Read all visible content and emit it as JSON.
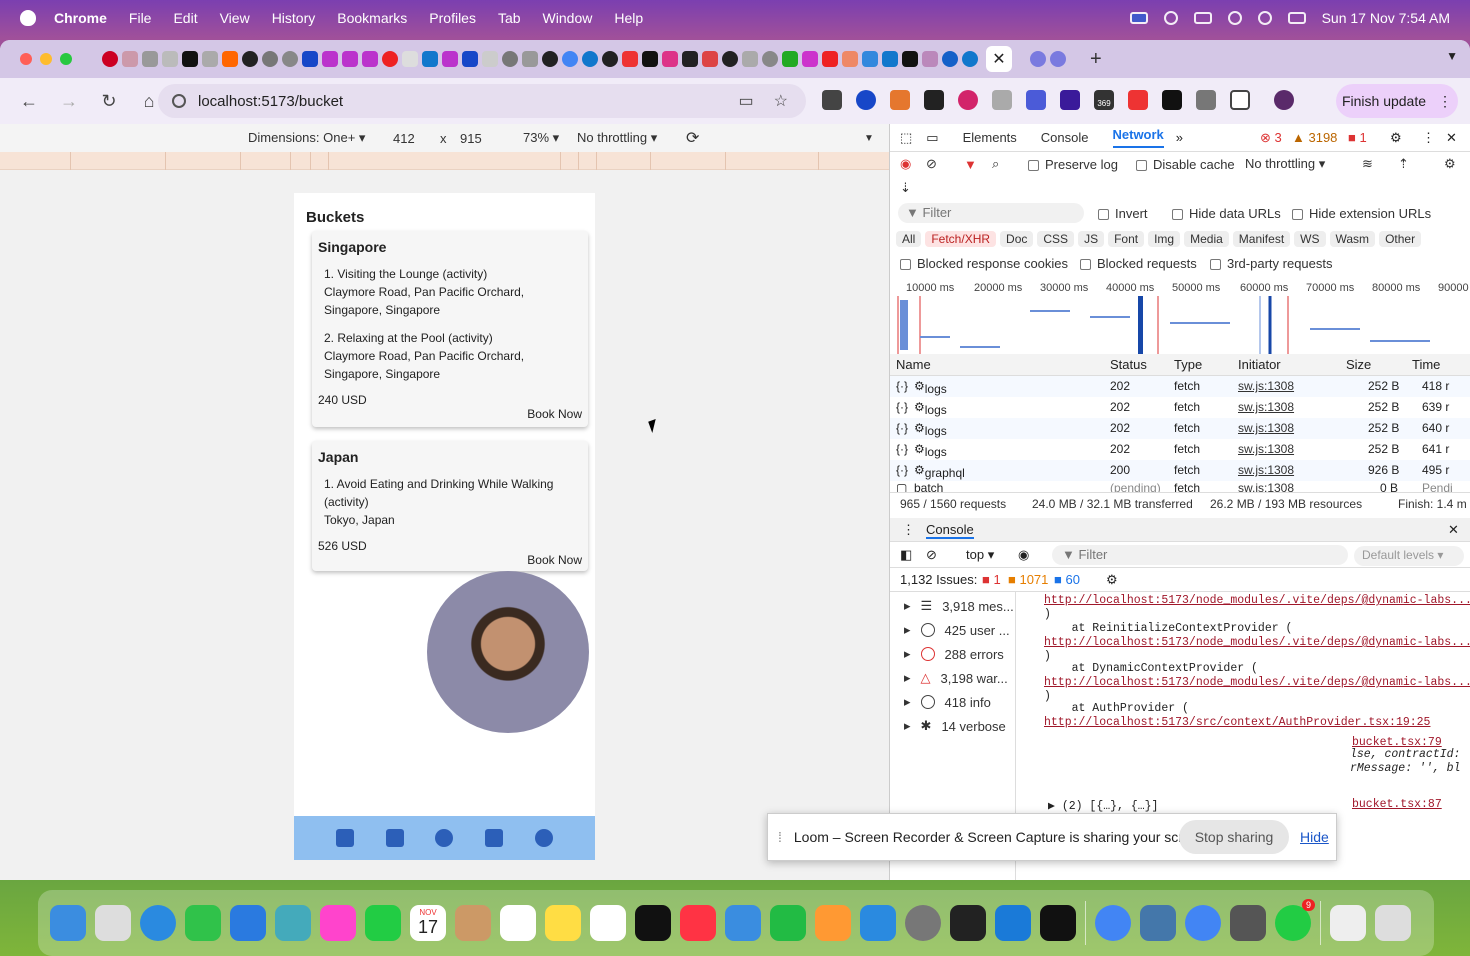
{
  "menubar": {
    "app_name": "Chrome",
    "items": [
      "File",
      "Edit",
      "View",
      "History",
      "Bookmarks",
      "Profiles",
      "Tab",
      "Window",
      "Help"
    ],
    "datetime": "Sun 17 Nov  7:54 AM"
  },
  "browser": {
    "url": "localhost:5173/bucket",
    "finish_update": "Finish update",
    "ext_badge": "369",
    "ext_badge_6": "6"
  },
  "device_toolbar": {
    "dimensions": "Dimensions: One+",
    "width": "412",
    "x": "x",
    "height": "915",
    "zoom": "73%",
    "throttle": "No throttling"
  },
  "app": {
    "title": "Buckets",
    "cards": [
      {
        "country": "Singapore",
        "items": [
          {
            "line1": "1. Visiting the Lounge (activity)",
            "line2": "Claymore Road, Pan Pacific Orchard,",
            "line3": "Singapore, Singapore"
          },
          {
            "line1": "2. Relaxing at the Pool (activity)",
            "line2": "Claymore Road, Pan Pacific Orchard,",
            "line3": "Singapore, Singapore"
          }
        ],
        "price": "240 USD",
        "book": "Book Now"
      },
      {
        "country": "Japan",
        "items": [
          {
            "line1": "1. Avoid Eating and Drinking While Walking",
            "line2": "(activity)",
            "line3": "Tokyo, Japan"
          }
        ],
        "price": "526 USD",
        "book": "Book Now"
      }
    ]
  },
  "devtools": {
    "tabs": [
      "Elements",
      "Console",
      "Network"
    ],
    "errors": "3",
    "warnings": "3198",
    "issues_count": "1",
    "preserve_log": "Preserve log",
    "disable_cache": "Disable cache",
    "throttling": "No throttling",
    "filter_placeholder": "Filter",
    "invert": "Invert",
    "hide_data_urls": "Hide data URLs",
    "hide_ext_urls": "Hide extension URLs",
    "filter_types": [
      "All",
      "Fetch/XHR",
      "Doc",
      "CSS",
      "JS",
      "Font",
      "Img",
      "Media",
      "Manifest",
      "WS",
      "Wasm",
      "Other"
    ],
    "blocked_cookies": "Blocked response cookies",
    "blocked_requests": "Blocked requests",
    "third_party": "3rd-party requests",
    "timeline_labels": [
      "10000 ms",
      "20000 ms",
      "30000 ms",
      "40000 ms",
      "50000 ms",
      "60000 ms",
      "70000 ms",
      "80000 ms",
      "90000"
    ],
    "columns": [
      "Name",
      "Status",
      "Type",
      "Initiator",
      "Size",
      "Time"
    ],
    "rows": [
      {
        "name": "logs",
        "status": "202",
        "type": "fetch",
        "initiator": "sw.js:1308",
        "size": "252 B",
        "time": "418 r"
      },
      {
        "name": "logs",
        "status": "202",
        "type": "fetch",
        "initiator": "sw.js:1308",
        "size": "252 B",
        "time": "639 r"
      },
      {
        "name": "logs",
        "status": "202",
        "type": "fetch",
        "initiator": "sw.js:1308",
        "size": "252 B",
        "time": "640 r"
      },
      {
        "name": "logs",
        "status": "202",
        "type": "fetch",
        "initiator": "sw.js:1308",
        "size": "252 B",
        "time": "641 r"
      },
      {
        "name": "graphql",
        "status": "200",
        "type": "fetch",
        "initiator": "sw.js:1308",
        "size": "926 B",
        "time": "495 r"
      },
      {
        "name": "batch",
        "status": "(pending)",
        "type": "fetch",
        "initiator": "sw.js:1308",
        "size": "0 B",
        "time": "Pendi"
      }
    ],
    "summary": {
      "requests": "965 / 1560 requests",
      "transferred": "24.0 MB / 32.1 MB transferred",
      "resources": "26.2 MB / 193 MB resources",
      "finish": "Finish: 1.4 m"
    },
    "console": {
      "title": "Console",
      "context": "top",
      "filter": "Filter",
      "levels": "Default levels",
      "issues_label": "1,132 Issues:",
      "issue_err": "1",
      "issue_warn": "1071",
      "issue_info": "60",
      "sidebar": [
        "3,918 mes...",
        "425 user ...",
        "288 errors",
        "3,198 war...",
        "418 info",
        "14 verbose"
      ],
      "log_lines": [
        {
          "type": "link",
          "text": "http://localhost:5173/node_modules/.vite/deps/@dynamic-labs..."
        },
        {
          "type": "plain",
          "text": ")"
        },
        {
          "type": "plain",
          "text": "    at ReinitializeContextProvider ("
        },
        {
          "type": "link",
          "text": "http://localhost:5173/node_modules/.vite/deps/@dynamic-labs..."
        },
        {
          "type": "plain",
          "text": ")"
        },
        {
          "type": "plain",
          "text": "    at DynamicContextProvider ("
        },
        {
          "type": "link",
          "text": "http://localhost:5173/node_modules/.vite/deps/@dynamic-labs..."
        },
        {
          "type": "plain",
          "text": ")"
        },
        {
          "type": "plain",
          "text": "    at AuthProvider ("
        },
        {
          "type": "link",
          "text": "http://localhost:5173/src/context/AuthProvider.tsx:19:25"
        }
      ],
      "src1": "bucket.tsx:79",
      "frag1": "lse, contractId:",
      "frag2": "rMessage: '', bl",
      "array_line": "▶ (2) [{…}, {…}]",
      "src2": "bucket.tsx:87",
      "prompt": "›"
    }
  },
  "loom": {
    "message": "Loom – Screen Recorder & Screen Capture is sharing your screen.",
    "stop": "Stop sharing",
    "hide": "Hide"
  },
  "dock": {
    "cal_month": "NOV",
    "cal_day": "17",
    "whatsapp_badge": "9"
  }
}
